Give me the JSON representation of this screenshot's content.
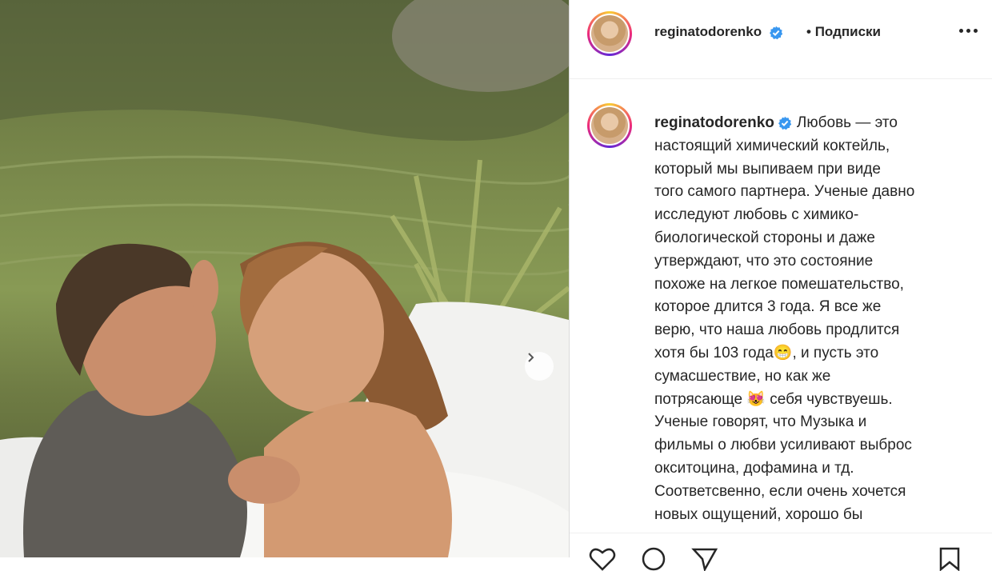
{
  "post": {
    "username": "reginatodorenko",
    "follow_separator": "•",
    "follow_status": "Подписки",
    "caption_username": "reginatodorenko",
    "caption_text": "Любовь — это\nнастоящий химический коктейль,\nкоторый мы выпиваем при виде\nтого самого партнера. Ученые давно\nисследуют любовь с химико-\nбиологической стороны и даже\nутверждают, что это состояние\nпохоже на легкое помешательство,\nкоторое длится 3 года. Я все же\nверю, что наша любовь продлится\nхотя бы 103 года😁, и пусть это\nсумасшествие, но как же\nпотрясающе 😻 себя чувствуешь.\nУченые говорят, что Музыка и\nфильмы о любви усиливают выброс\nокситоцина, дофамина и тд.\nСоответсвенно, если очень хочется\nновых ощущений, хорошо бы"
  },
  "colors": {
    "text": "#262626",
    "verified": "#3897f0",
    "divider": "#dbdbdb"
  },
  "icons": {
    "verified": "verified-badge-icon",
    "more": "more-options-icon",
    "next": "chevron-right-icon",
    "like": "heart-icon",
    "comment": "comment-icon",
    "share": "paper-plane-icon",
    "save": "bookmark-icon"
  }
}
